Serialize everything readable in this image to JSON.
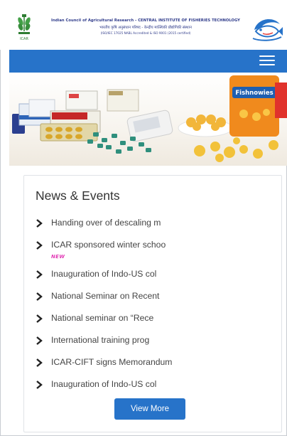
{
  "header": {
    "line1": "Indian Council of Agricultural Research - CENTRAL INSTITUTE OF FISHERIES TECHNOLOGY",
    "line2": "भारतीय कृषि अनुसंधान परिषद - केन्द्रीय मात्स्यिकी प्रौद्योगिकी संस्थान",
    "line3": "(ISO/IEC 17025 NABL Accredited & ISO 9001 (2015 certified)",
    "emblem_label": "ICAR"
  },
  "nav": {
    "menu_icon": "hamburger-menu-icon"
  },
  "banner": {
    "snack_brand": "Fishnowies"
  },
  "news": {
    "title": "News & Events",
    "items": [
      {
        "text": "Handing over of descaling m"
      },
      {
        "text": "ICAR sponsored winter schoo",
        "badge": "NEW"
      },
      {
        "text": "Inauguration of Indo-US col"
      },
      {
        "text": "National Seminar on Recent"
      },
      {
        "text": "National seminar on “Rece"
      },
      {
        "text": "International training prog"
      },
      {
        "text": "ICAR-CIFT signs Memorandum"
      },
      {
        "text": "Inauguration of Indo-US col"
      }
    ],
    "view_more_label": "View More"
  },
  "colors": {
    "primary": "#2773c9",
    "badge": "#e23bb6",
    "header_text": "#2f3b8a"
  }
}
